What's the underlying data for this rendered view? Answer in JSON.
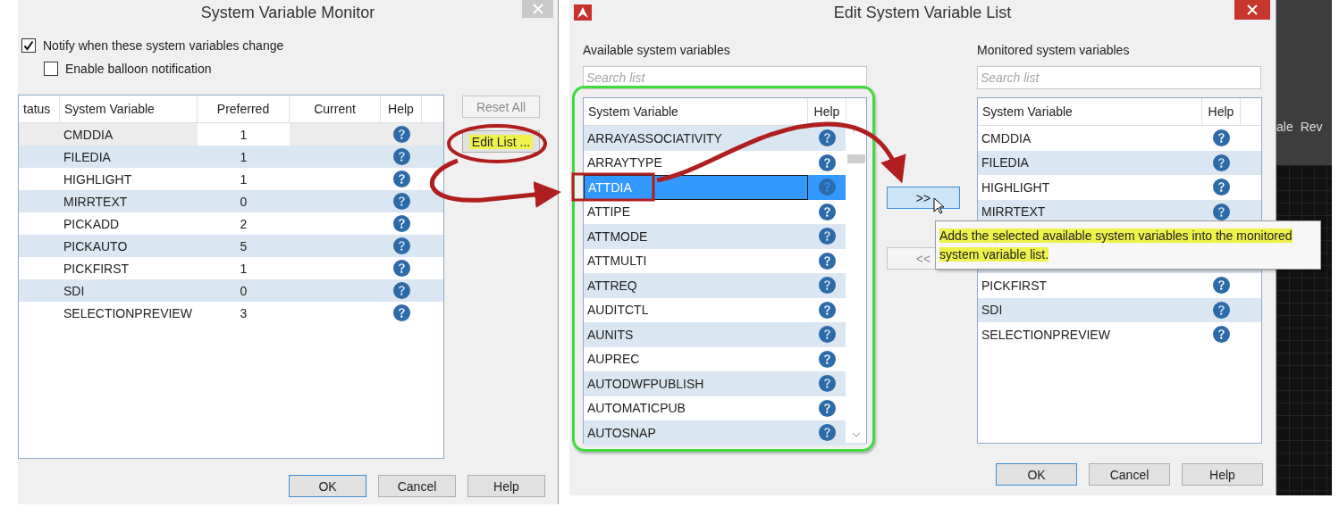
{
  "monitor_dialog": {
    "title": "System Variable Monitor",
    "options": [
      {
        "label": "Notify when these system variables change",
        "checked": true
      },
      {
        "label": "Enable balloon notification",
        "checked": false
      }
    ],
    "table": {
      "columns": [
        "tatus",
        "System Variable",
        "Preferred",
        "Current",
        "Help"
      ],
      "rows": [
        {
          "name": "CMDDIA",
          "preferred": "1",
          "selected": true
        },
        {
          "name": "FILEDIA",
          "preferred": "1",
          "selected": false
        },
        {
          "name": "HIGHLIGHT",
          "preferred": "1",
          "selected": false
        },
        {
          "name": "MIRRTEXT",
          "preferred": "0",
          "selected": false
        },
        {
          "name": "PICKADD",
          "preferred": "2",
          "selected": false
        },
        {
          "name": "PICKAUTO",
          "preferred": "5",
          "selected": false
        },
        {
          "name": "PICKFIRST",
          "preferred": "1",
          "selected": false
        },
        {
          "name": "SDI",
          "preferred": "0",
          "selected": false
        },
        {
          "name": "SELECTIONPREVIEW",
          "preferred": "3",
          "selected": false
        }
      ]
    },
    "side_buttons": [
      {
        "label": "Reset All",
        "disabled": true,
        "highlighted": false
      },
      {
        "label": "Edit List ...",
        "disabled": false,
        "highlighted": true
      }
    ],
    "buttons": [
      {
        "label": "OK",
        "default": true
      },
      {
        "label": "Cancel",
        "default": false
      },
      {
        "label": "Help",
        "default": false
      }
    ]
  },
  "edit_dialog": {
    "title": "Edit System Variable List",
    "available": {
      "label": "Available system variables",
      "search_placeholder": "Search list",
      "columns": [
        "System Variable",
        "Help"
      ],
      "rows": [
        {
          "name": "ARRAYASSOCIATIVITY",
          "selected": false
        },
        {
          "name": "ARRAYTYPE",
          "selected": false
        },
        {
          "name": "ATTDIA",
          "selected": true
        },
        {
          "name": "ATTIPE",
          "selected": false
        },
        {
          "name": "ATTMODE",
          "selected": false
        },
        {
          "name": "ATTMULTI",
          "selected": false
        },
        {
          "name": "ATTREQ",
          "selected": false
        },
        {
          "name": "AUDITCTL",
          "selected": false
        },
        {
          "name": "AUNITS",
          "selected": false
        },
        {
          "name": "AUPREC",
          "selected": false
        },
        {
          "name": "AUTODWFPUBLISH",
          "selected": false
        },
        {
          "name": "AUTOMATICPUB",
          "selected": false
        },
        {
          "name": "AUTOSNAP",
          "selected": false
        }
      ]
    },
    "transfer_buttons": [
      {
        "label": ">>",
        "disabled": false
      },
      {
        "label": "<<",
        "disabled": true
      }
    ],
    "monitored": {
      "label": "Monitored system variables",
      "search_placeholder": "Search list",
      "columns": [
        "System Variable",
        "Help"
      ],
      "rows_above_tooltip": [
        {
          "name": "CMDDIA"
        },
        {
          "name": "FILEDIA"
        },
        {
          "name": "HIGHLIGHT"
        },
        {
          "name": "MIRRTEXT"
        }
      ],
      "rows_below_tooltip": [
        {
          "name": "PICKFIRST"
        },
        {
          "name": "SDI"
        },
        {
          "name": "SELECTIONPREVIEW"
        }
      ]
    },
    "tooltip": "Adds the selected available system variables into the monitored system variable list.",
    "buttons": [
      {
        "label": "OK",
        "default": true
      },
      {
        "label": "Cancel",
        "default": false
      },
      {
        "label": "Help",
        "default": false
      }
    ]
  },
  "background": {
    "labels": [
      "ale",
      "Rev"
    ]
  }
}
